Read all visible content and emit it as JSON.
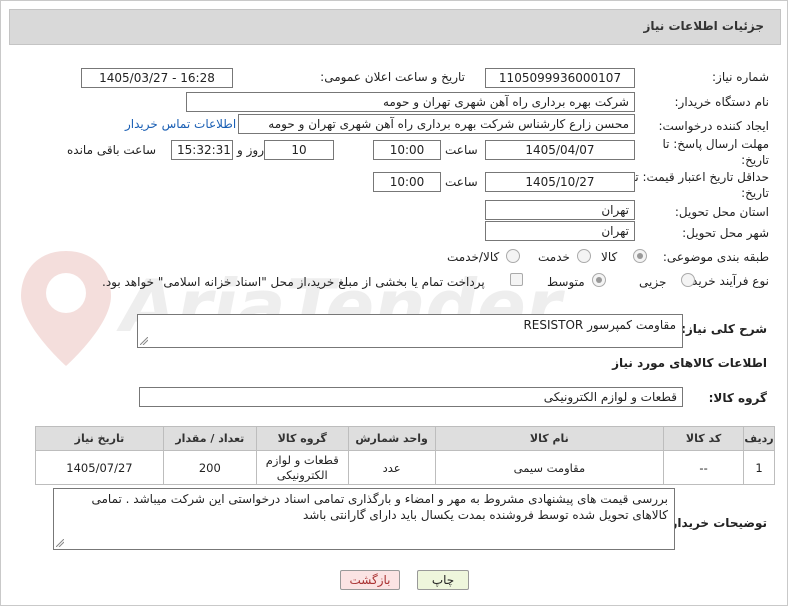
{
  "header": {
    "title": "جزئیات اطلاعات نیاز"
  },
  "fields": {
    "need_number_label": "شماره نیاز:",
    "need_number": "1105099936000107",
    "announce_label": "تاریخ و ساعت اعلان عمومی:",
    "announce_value": "1405/03/27 - 16:28",
    "buyer_org_label": "نام دستگاه خریدار:",
    "buyer_org": "شرکت بهره برداری راه آهن شهری تهران و حومه",
    "creator_label": "ایجاد کننده درخواست:",
    "creator": "محسن زارع کارشناس شرکت بهره برداری راه آهن شهری تهران و حومه",
    "buyer_contact_link": "اطلاعات تماس خریدار",
    "reply_deadline_label": "مهلت ارسال پاسخ: تا تاریخ:",
    "reply_date": "1405/04/07",
    "hour_label": "ساعت",
    "reply_time": "10:00",
    "days_value": "10",
    "days_label": "روز و",
    "remaining_time": "15:32:31",
    "remaining_label": "ساعت باقی مانده",
    "price_validity_label": "حداقل تاریخ اعتبار قیمت: تا تاریخ:",
    "price_date": "1405/10/27",
    "price_time": "10:00",
    "province_label": "استان محل تحویل:",
    "province": "تهران",
    "city_label": "شهر محل تحویل:",
    "city": "تهران",
    "category_label": "طبقه بندی موضوعی:",
    "category_options": [
      "کالا",
      "خدمت",
      "کالا/خدمت"
    ],
    "process_label": "نوع فرآیند خرید :",
    "process_options": [
      "جزیی",
      "متوسط"
    ],
    "payment_note": "پرداخت تمام یا بخشی از مبلغ خرید،از محل \"اسناد خزانه اسلامی\" خواهد بود."
  },
  "description": {
    "label": "شرح کلی نیاز:",
    "value": "مقاومت کمپرسور RESISTOR"
  },
  "goods_section": {
    "title": "اطلاعات کالاهای مورد نیاز",
    "group_label": "گروه کالا:",
    "group_value": "قطعات و لوازم الکترونیکی"
  },
  "table": {
    "headers": [
      "ردیف",
      "کد کالا",
      "نام کالا",
      "واحد شمارش",
      "گروه کالا",
      "تعداد / مقدار",
      "تاریخ نیاز"
    ],
    "rows": [
      {
        "row": "1",
        "code": "--",
        "name": "مقاومت سیمی",
        "unit": "عدد",
        "group": "قطعات و لوازم الکترونیکی",
        "qty": "200",
        "date": "1405/07/27"
      }
    ]
  },
  "buyer_notes": {
    "label": "توضیحات خریدار:",
    "value": "بررسی قیمت های پیشنهادی مشروط به مهر و امضاء و بارگذاری تمامی اسناد درخواستی این شرکت میباشد . تمامی کالاهای تحویل شده توسط فروشنده بمدت یکسال باید دارای گارانتی باشد"
  },
  "buttons": {
    "print": "چاپ",
    "back": "بازگشت"
  },
  "watermark": {
    "text": "AriaTender.net"
  },
  "colors": {
    "link": "#1a5fb4",
    "header_bg": "#d9d9d9",
    "print_bg": "#eef6dc",
    "back_bg": "#fbe3e3",
    "watermark": "#c0392b"
  }
}
